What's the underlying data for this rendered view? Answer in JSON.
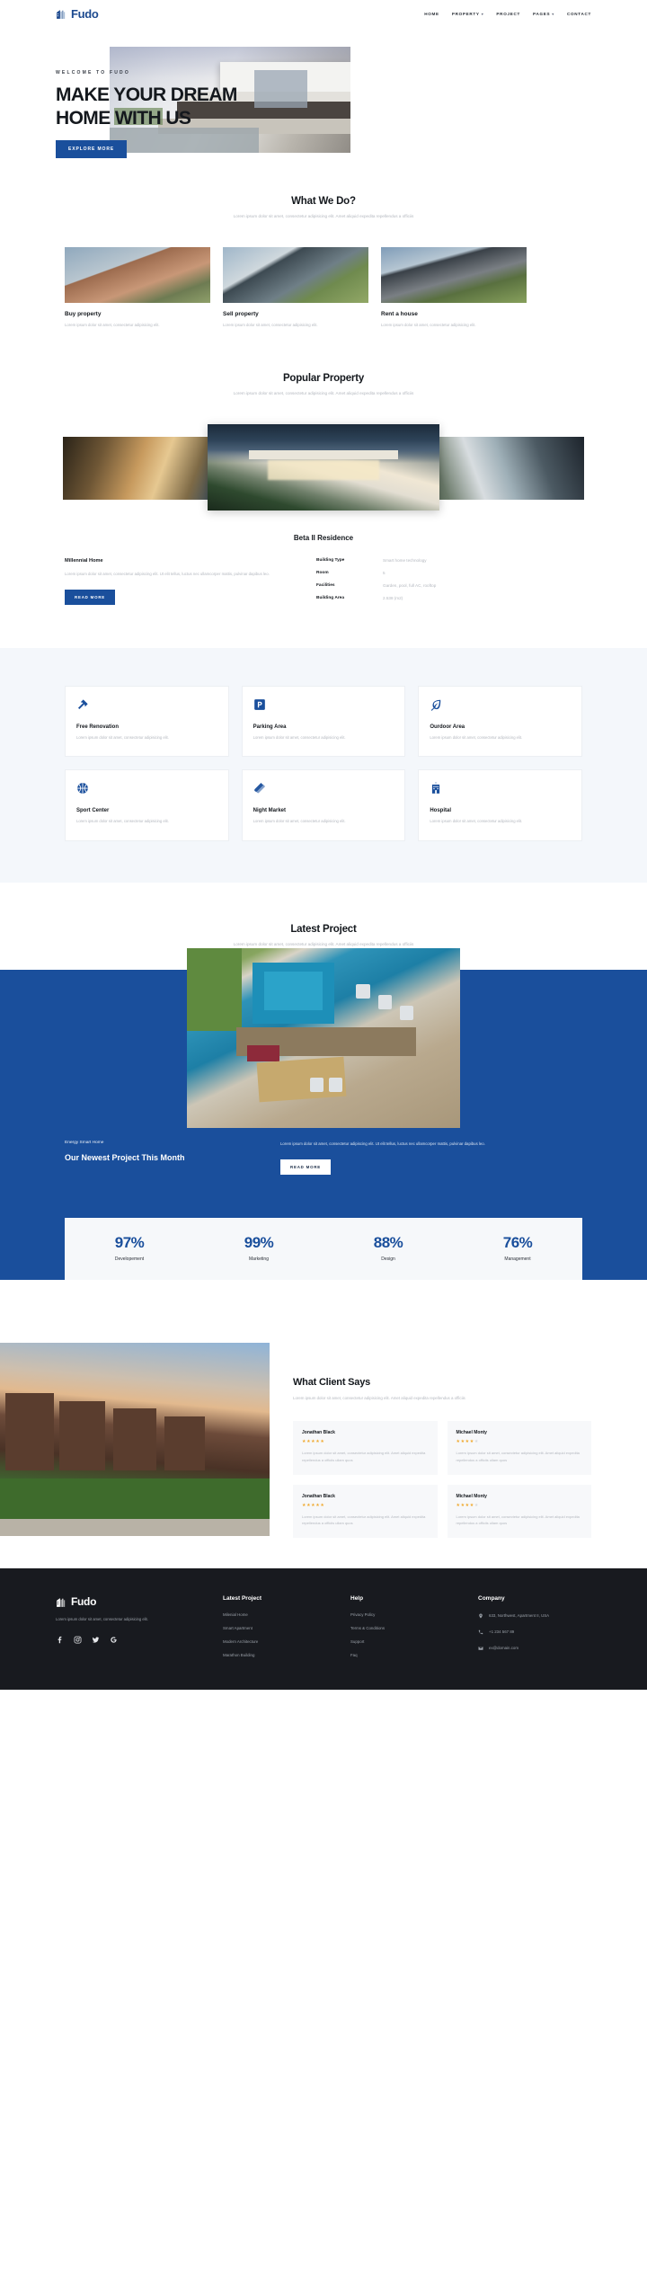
{
  "brand": {
    "name": "Fudo",
    "icon": "building-icon"
  },
  "nav": {
    "items": [
      {
        "label": "HOME",
        "has_caret": false
      },
      {
        "label": "PROPERTY",
        "has_caret": true
      },
      {
        "label": "PROJECT",
        "has_caret": false
      },
      {
        "label": "PAGES",
        "has_caret": true
      },
      {
        "label": "CONTACT",
        "has_caret": false
      }
    ]
  },
  "hero": {
    "eyebrow": "WELCOME TO FUDO",
    "title_line1": "MAKE YOUR DREAM",
    "title_line2": "HOME WITH US",
    "cta": "EXPLORE MORE"
  },
  "what_we_do": {
    "title": "What We Do?",
    "subtitle": "Lorem ipsum dolor sit amet, consectetur adipisicing elit. Amet aliquid expedita repellendus a officiis",
    "cards": [
      {
        "title": "Buy property",
        "text": "Lorem ipsum dolor sit amet, consectetur adipisicing elit."
      },
      {
        "title": "Sell property",
        "text": "Lorem ipsum dolor sit amet, consectetur adipisicing elit."
      },
      {
        "title": "Rent a house",
        "text": "Lorem ipsum dolor sit amet, consectetur adipisicing elit."
      }
    ]
  },
  "popular": {
    "title": "Popular Property",
    "subtitle": "Lorem ipsum dolor sit amet, consectetur adipisicing elit. Amet aliquid expedita repellendus a officiis",
    "property_name": "Beta II Residence",
    "detail_title": "Millennial Home",
    "detail_text": "Lorem ipsum dolor sit amet, consectetur adipiscing elit. Ut elit tellus, luctus nec ullamcorper mattis, pulvinar dapibus leo.",
    "cta": "READ MORE",
    "specs": [
      {
        "key": "Building Type",
        "value": "Smart home technology"
      },
      {
        "key": "Room",
        "value": "5"
      },
      {
        "key": "Facilities",
        "value": "Garden, pool, full AC, rooftop"
      },
      {
        "key": "Building Area",
        "value": "2.538 (m2)"
      }
    ]
  },
  "features": {
    "items": [
      {
        "icon": "hammer-icon",
        "title": "Free Renovation",
        "text": "Lorem ipsum dolor sit amet, consectetur adipisicing elit."
      },
      {
        "icon": "parking-icon",
        "title": "Parking Area",
        "text": "Lorem ipsum dolor sit amet, consectetur adipisicing elit."
      },
      {
        "icon": "leaf-icon",
        "title": "Ourdoor Area",
        "text": "Lorem ipsum dolor sit amet, consectetur adipisicing elit."
      },
      {
        "icon": "basketball-icon",
        "title": "Sport Center",
        "text": "Lorem ipsum dolor sit amet, consectetur adipisicing elit."
      },
      {
        "icon": "noodles-icon",
        "title": "Night Market",
        "text": "Lorem ipsum dolor sit amet, consectetur adipisicing elit."
      },
      {
        "icon": "hospital-icon",
        "title": "Hospital",
        "text": "Lorem ipsum dolor sit amet, consectetur adipisicing elit."
      }
    ]
  },
  "latest_project": {
    "title": "Latest Project",
    "subtitle": "Lorem ipsum dolor sit amet, consectetur adipisicing elit. Amet aliquid expedita repellendus a officiis",
    "eyebrow": "Energy Smart Home",
    "heading": "Our Newest Project This Month",
    "text": "Lorem ipsum dolor sit amet, consectetur adipiscing elit. Ut elit tellus, luctus nec ullamcorper mattis, pulvinar dapibus leo.",
    "cta": "READ MORE"
  },
  "stats": [
    {
      "value": "97%",
      "label": "Developement"
    },
    {
      "value": "99%",
      "label": "Marketing"
    },
    {
      "value": "88%",
      "label": "Design"
    },
    {
      "value": "76%",
      "label": "Management"
    }
  ],
  "testimonials": {
    "title": "What Client Says",
    "subtitle": "Lorem ipsum dolor sit amet, consectetur adipisicing elit. Amet aliquid expedita repellendus a officiis",
    "items": [
      {
        "name": "Jonathan Black",
        "rating": 5,
        "text": "Lorem ipsum dolor sit amet, consectetur adipisicing elit. Amet aliquid expedita repellendus a officiis ullam quos"
      },
      {
        "name": "Michael Monty",
        "rating": 4,
        "text": "Lorem ipsum dolor sit amet, consectetur adipisicing elit. Amet aliquid expedita repellendus a officiis ullam quos"
      },
      {
        "name": "Jonathan Black",
        "rating": 5,
        "text": "Lorem ipsum dolor sit amet, consectetur adipisicing elit. Amet aliquid expedita repellendus a officiis ullam quos"
      },
      {
        "name": "Michael Monty",
        "rating": 4,
        "text": "Lorem ipsum dolor sit amet, consectetur adipisicing elit. Amet aliquid expedita repellendus a officiis ullam quos"
      }
    ]
  },
  "footer": {
    "brand": "Fudo",
    "about": "Lorem ipsum dolor sit amet, consectetur adipisicing elit.",
    "socials": [
      "facebook-icon",
      "instagram-icon",
      "twitter-icon",
      "google-icon"
    ],
    "columns": [
      {
        "title": "Latest Project",
        "links": [
          "Milenial Home",
          "Smart Apartment",
          "Modern Architecture",
          "Marathon Building"
        ]
      },
      {
        "title": "Help",
        "links": [
          "Privacy Policy",
          "Terms & Conditions",
          "Support",
          "Faq"
        ]
      }
    ],
    "company": {
      "title": "Company",
      "address": "633, Northwest, Apartment II, USA",
      "phone": "+1 234 567 89",
      "email": "ex@domain.com"
    }
  },
  "colors": {
    "accent": "#1a4f9c",
    "dark": "#181a1f",
    "star": "#f0a92e"
  }
}
